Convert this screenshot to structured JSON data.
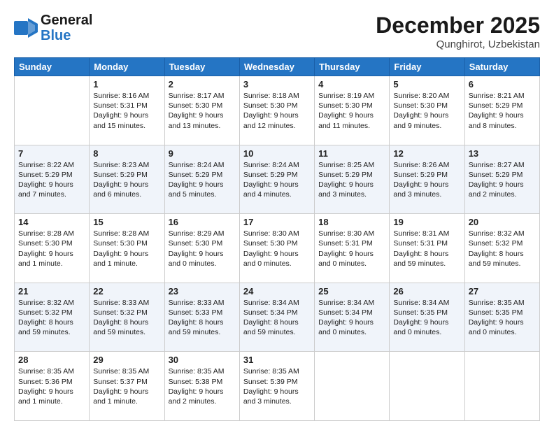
{
  "header": {
    "logo_general": "General",
    "logo_blue": "Blue",
    "month_title": "December 2025",
    "location": "Qunghirot, Uzbekistan"
  },
  "weekdays": [
    "Sunday",
    "Monday",
    "Tuesday",
    "Wednesday",
    "Thursday",
    "Friday",
    "Saturday"
  ],
  "weeks": [
    [
      {
        "day": "",
        "sunrise": "",
        "sunset": "",
        "daylight": ""
      },
      {
        "day": "1",
        "sunrise": "Sunrise: 8:16 AM",
        "sunset": "Sunset: 5:31 PM",
        "daylight": "Daylight: 9 hours and 15 minutes."
      },
      {
        "day": "2",
        "sunrise": "Sunrise: 8:17 AM",
        "sunset": "Sunset: 5:30 PM",
        "daylight": "Daylight: 9 hours and 13 minutes."
      },
      {
        "day": "3",
        "sunrise": "Sunrise: 8:18 AM",
        "sunset": "Sunset: 5:30 PM",
        "daylight": "Daylight: 9 hours and 12 minutes."
      },
      {
        "day": "4",
        "sunrise": "Sunrise: 8:19 AM",
        "sunset": "Sunset: 5:30 PM",
        "daylight": "Daylight: 9 hours and 11 minutes."
      },
      {
        "day": "5",
        "sunrise": "Sunrise: 8:20 AM",
        "sunset": "Sunset: 5:30 PM",
        "daylight": "Daylight: 9 hours and 9 minutes."
      },
      {
        "day": "6",
        "sunrise": "Sunrise: 8:21 AM",
        "sunset": "Sunset: 5:29 PM",
        "daylight": "Daylight: 9 hours and 8 minutes."
      }
    ],
    [
      {
        "day": "7",
        "sunrise": "Sunrise: 8:22 AM",
        "sunset": "Sunset: 5:29 PM",
        "daylight": "Daylight: 9 hours and 7 minutes."
      },
      {
        "day": "8",
        "sunrise": "Sunrise: 8:23 AM",
        "sunset": "Sunset: 5:29 PM",
        "daylight": "Daylight: 9 hours and 6 minutes."
      },
      {
        "day": "9",
        "sunrise": "Sunrise: 8:24 AM",
        "sunset": "Sunset: 5:29 PM",
        "daylight": "Daylight: 9 hours and 5 minutes."
      },
      {
        "day": "10",
        "sunrise": "Sunrise: 8:24 AM",
        "sunset": "Sunset: 5:29 PM",
        "daylight": "Daylight: 9 hours and 4 minutes."
      },
      {
        "day": "11",
        "sunrise": "Sunrise: 8:25 AM",
        "sunset": "Sunset: 5:29 PM",
        "daylight": "Daylight: 9 hours and 3 minutes."
      },
      {
        "day": "12",
        "sunrise": "Sunrise: 8:26 AM",
        "sunset": "Sunset: 5:29 PM",
        "daylight": "Daylight: 9 hours and 3 minutes."
      },
      {
        "day": "13",
        "sunrise": "Sunrise: 8:27 AM",
        "sunset": "Sunset: 5:29 PM",
        "daylight": "Daylight: 9 hours and 2 minutes."
      }
    ],
    [
      {
        "day": "14",
        "sunrise": "Sunrise: 8:28 AM",
        "sunset": "Sunset: 5:30 PM",
        "daylight": "Daylight: 9 hours and 1 minute."
      },
      {
        "day": "15",
        "sunrise": "Sunrise: 8:28 AM",
        "sunset": "Sunset: 5:30 PM",
        "daylight": "Daylight: 9 hours and 1 minute."
      },
      {
        "day": "16",
        "sunrise": "Sunrise: 8:29 AM",
        "sunset": "Sunset: 5:30 PM",
        "daylight": "Daylight: 9 hours and 0 minutes."
      },
      {
        "day": "17",
        "sunrise": "Sunrise: 8:30 AM",
        "sunset": "Sunset: 5:30 PM",
        "daylight": "Daylight: 9 hours and 0 minutes."
      },
      {
        "day": "18",
        "sunrise": "Sunrise: 8:30 AM",
        "sunset": "Sunset: 5:31 PM",
        "daylight": "Daylight: 9 hours and 0 minutes."
      },
      {
        "day": "19",
        "sunrise": "Sunrise: 8:31 AM",
        "sunset": "Sunset: 5:31 PM",
        "daylight": "Daylight: 8 hours and 59 minutes."
      },
      {
        "day": "20",
        "sunrise": "Sunrise: 8:32 AM",
        "sunset": "Sunset: 5:32 PM",
        "daylight": "Daylight: 8 hours and 59 minutes."
      }
    ],
    [
      {
        "day": "21",
        "sunrise": "Sunrise: 8:32 AM",
        "sunset": "Sunset: 5:32 PM",
        "daylight": "Daylight: 8 hours and 59 minutes."
      },
      {
        "day": "22",
        "sunrise": "Sunrise: 8:33 AM",
        "sunset": "Sunset: 5:32 PM",
        "daylight": "Daylight: 8 hours and 59 minutes."
      },
      {
        "day": "23",
        "sunrise": "Sunrise: 8:33 AM",
        "sunset": "Sunset: 5:33 PM",
        "daylight": "Daylight: 8 hours and 59 minutes."
      },
      {
        "day": "24",
        "sunrise": "Sunrise: 8:34 AM",
        "sunset": "Sunset: 5:34 PM",
        "daylight": "Daylight: 8 hours and 59 minutes."
      },
      {
        "day": "25",
        "sunrise": "Sunrise: 8:34 AM",
        "sunset": "Sunset: 5:34 PM",
        "daylight": "Daylight: 9 hours and 0 minutes."
      },
      {
        "day": "26",
        "sunrise": "Sunrise: 8:34 AM",
        "sunset": "Sunset: 5:35 PM",
        "daylight": "Daylight: 9 hours and 0 minutes."
      },
      {
        "day": "27",
        "sunrise": "Sunrise: 8:35 AM",
        "sunset": "Sunset: 5:35 PM",
        "daylight": "Daylight: 9 hours and 0 minutes."
      }
    ],
    [
      {
        "day": "28",
        "sunrise": "Sunrise: 8:35 AM",
        "sunset": "Sunset: 5:36 PM",
        "daylight": "Daylight: 9 hours and 1 minute."
      },
      {
        "day": "29",
        "sunrise": "Sunrise: 8:35 AM",
        "sunset": "Sunset: 5:37 PM",
        "daylight": "Daylight: 9 hours and 1 minute."
      },
      {
        "day": "30",
        "sunrise": "Sunrise: 8:35 AM",
        "sunset": "Sunset: 5:38 PM",
        "daylight": "Daylight: 9 hours and 2 minutes."
      },
      {
        "day": "31",
        "sunrise": "Sunrise: 8:35 AM",
        "sunset": "Sunset: 5:39 PM",
        "daylight": "Daylight: 9 hours and 3 minutes."
      },
      {
        "day": "",
        "sunrise": "",
        "sunset": "",
        "daylight": ""
      },
      {
        "day": "",
        "sunrise": "",
        "sunset": "",
        "daylight": ""
      },
      {
        "day": "",
        "sunrise": "",
        "sunset": "",
        "daylight": ""
      }
    ]
  ]
}
